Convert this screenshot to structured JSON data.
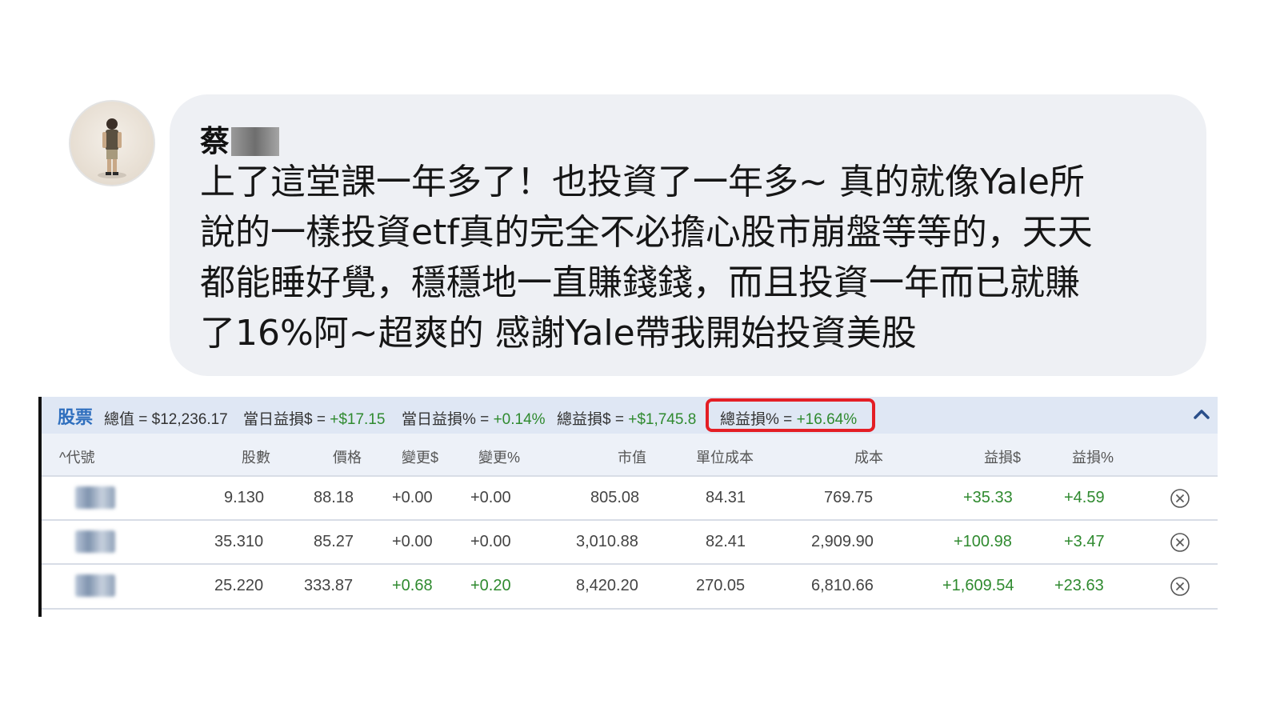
{
  "comment": {
    "author_visible": "蔡",
    "lines": [
      "上了這堂課一年多了！也投資了一年多~ 真的就像Yale所",
      "說的一樣投資etf真的完全不必擔心股市崩盤等等的，天天",
      "都能睡好覺，穩穩地一直賺錢錢，而且投資一年而已就賺",
      "了16%阿~超爽的 感謝Yale帶我開始投資美股"
    ]
  },
  "portfolio": {
    "title": "股票",
    "summary": {
      "total_value_label": "總值 = ",
      "total_value": "$12,236.17",
      "day_gain_label": "當日益損$ = ",
      "day_gain": "+$17.15",
      "day_gain_pct_label": "當日益損% = ",
      "day_gain_pct": "+0.14%",
      "total_gain_label": "總益損$ = ",
      "total_gain": "+$1,745.8",
      "total_gain_pct_label": "總益損% = ",
      "total_gain_pct": "+16.64%"
    },
    "columns": [
      "^代號",
      "股數",
      "價格",
      "變更$",
      "變更%",
      "市值",
      "單位成本",
      "成本",
      "益損$",
      "益損%"
    ],
    "rows": [
      {
        "shares": "9.130",
        "price": "88.18",
        "chg": "+0.00",
        "chg_pct": "+0.00",
        "mkt_value": "805.08",
        "unit_cost": "84.31",
        "cost": "769.75",
        "gain": "+35.33",
        "gain_pct": "+4.59"
      },
      {
        "shares": "35.310",
        "price": "85.27",
        "chg": "+0.00",
        "chg_pct": "+0.00",
        "mkt_value": "3,010.88",
        "unit_cost": "82.41",
        "cost": "2,909.90",
        "gain": "+100.98",
        "gain_pct": "+3.47"
      },
      {
        "shares": "25.220",
        "price": "333.87",
        "chg": "+0.68",
        "chg_pct": "+0.20",
        "mkt_value": "8,420.20",
        "unit_cost": "270.05",
        "cost": "6,810.66",
        "gain": "+1,609.54",
        "gain_pct": "+23.63"
      }
    ]
  },
  "colors": {
    "positive": "#2f8a2f",
    "title_blue": "#2f6fbe",
    "highlight_red": "#e41e25",
    "bubble": "#eef0f4"
  },
  "icons": [
    "avatar",
    "chevron-up-icon",
    "remove-circle-icon"
  ]
}
